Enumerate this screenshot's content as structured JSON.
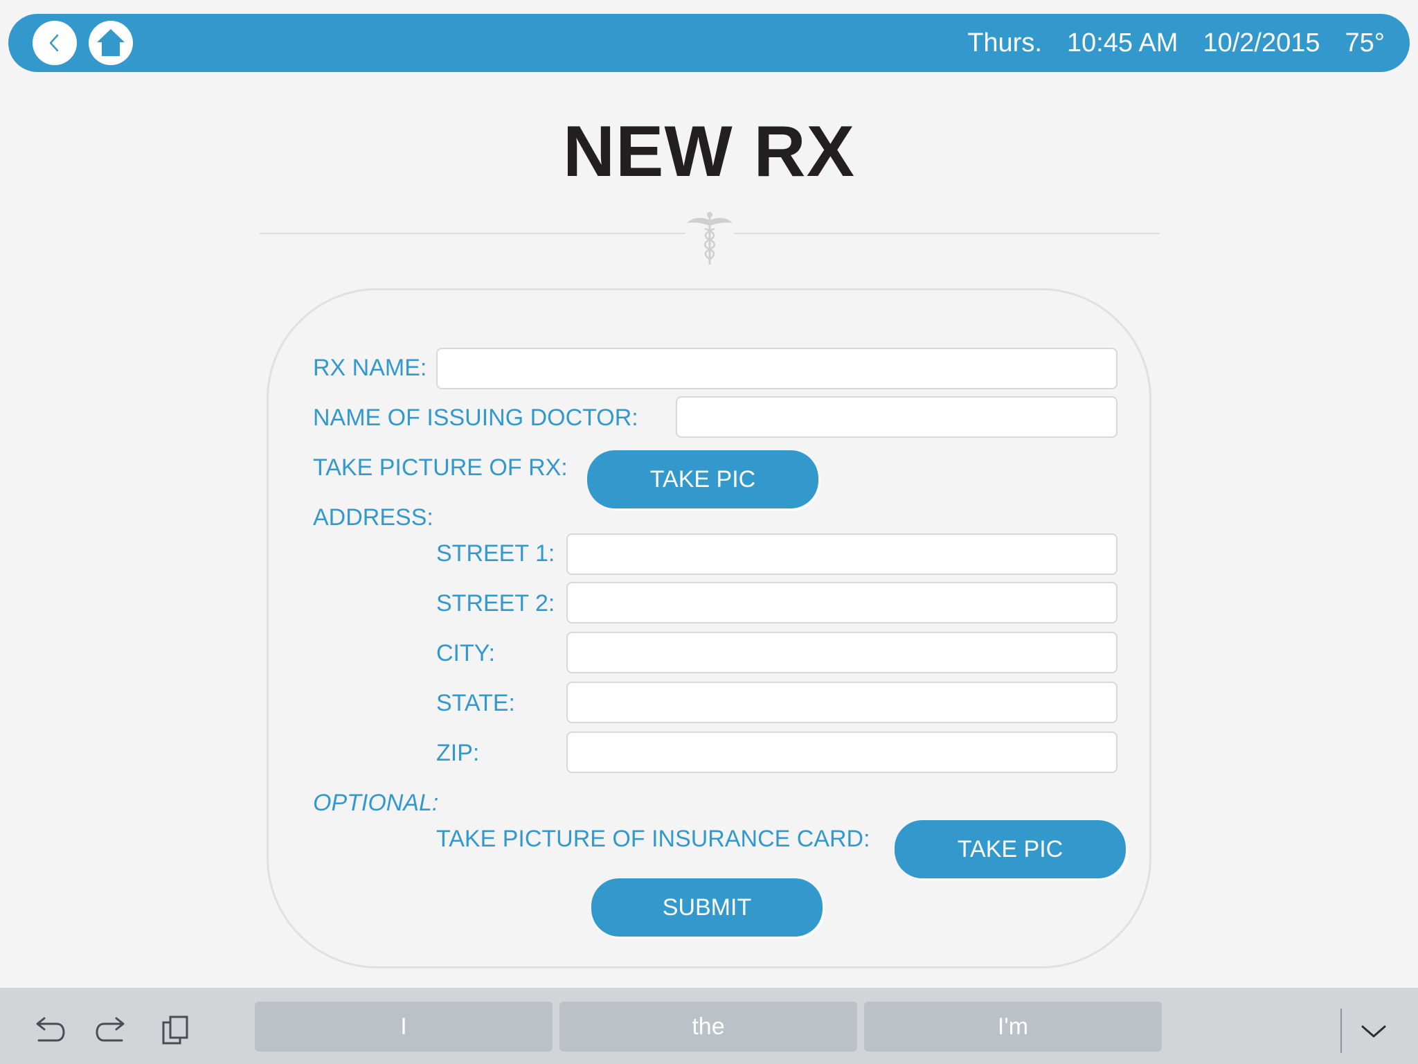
{
  "status_bar": {
    "day": "Thurs.",
    "time": "10:45 AM",
    "date": "10/2/2015",
    "temperature": "75°"
  },
  "page": {
    "title": "NEW RX"
  },
  "form": {
    "rx_name_label": "RX NAME:",
    "rx_name_value": "",
    "doctor_label": "NAME OF ISSUING DOCTOR:",
    "doctor_value": "",
    "rx_picture_label": "TAKE PICTURE OF RX:",
    "rx_picture_button": "TAKE PIC",
    "address_label": "ADDRESS:",
    "street1_label": "STREET 1:",
    "street1_value": "",
    "street2_label": "STREET 2:",
    "street2_value": "",
    "city_label": "CITY:",
    "city_value": "",
    "state_label": "STATE:",
    "state_value": "",
    "zip_label": "ZIP:",
    "zip_value": "",
    "optional_label": "OPTIONAL:",
    "insurance_label": "TAKE PICTURE OF INSURANCE CARD:",
    "insurance_button": "TAKE PIC",
    "submit_button": "SUBMIT"
  },
  "keyboard_bar": {
    "suggestions": [
      "I",
      "the",
      "I'm"
    ],
    "icons": [
      "undo-icon",
      "redo-icon",
      "paste-icon",
      "hide-keyboard-icon"
    ]
  },
  "colors": {
    "accent": "#3399cc",
    "background": "#f4f4f5",
    "title": "#231f20",
    "keyboard_bar": "#d2d4d8",
    "suggestion": "#bcc1c8"
  }
}
